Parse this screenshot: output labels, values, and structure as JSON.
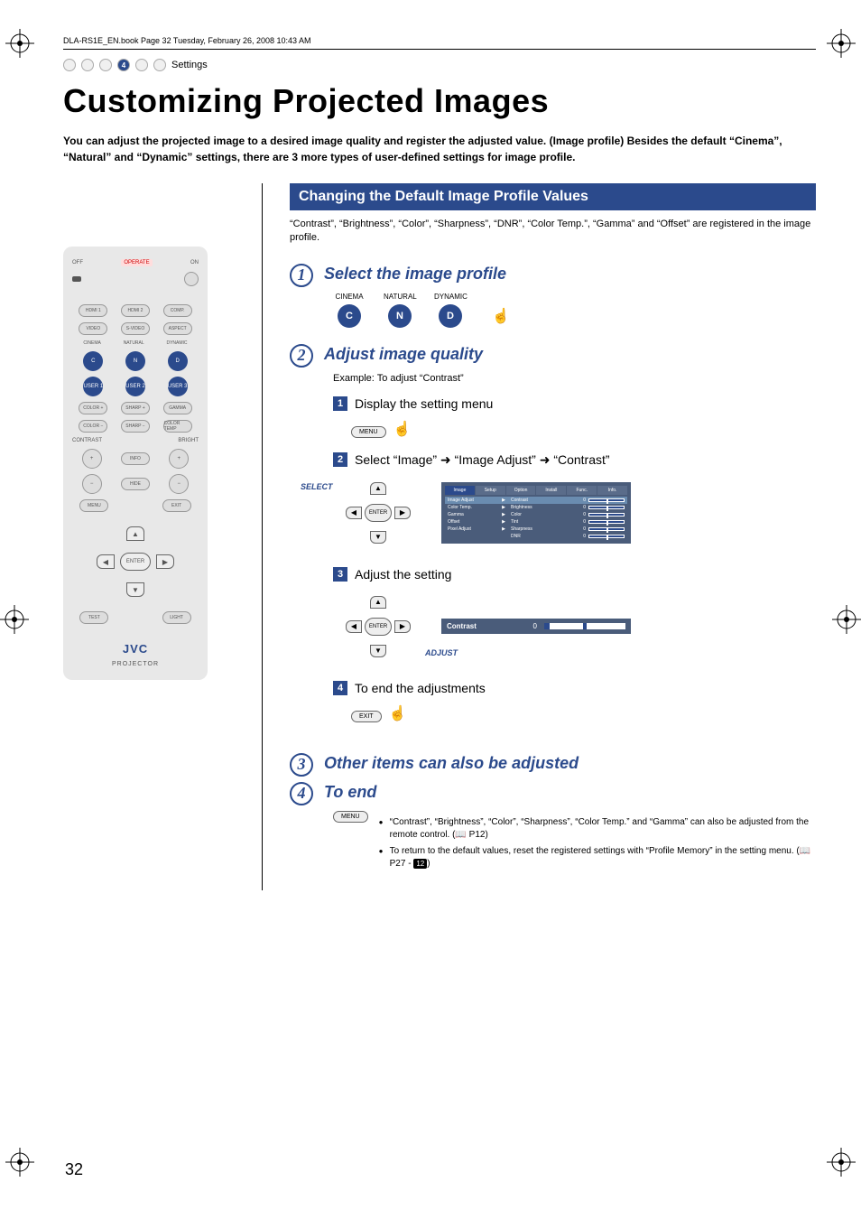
{
  "header_line": "DLA-RS1E_EN.book  Page 32  Tuesday, February 26, 2008  10:43 AM",
  "nav": {
    "num": "4",
    "label": "Settings"
  },
  "title": "Customizing Projected Images",
  "intro": "You can adjust the projected image to a desired image quality and register the adjusted value. (Image profile) Besides the default “Cinema”, “Natural” and “Dynamic” settings, there are 3 more types of user-defined settings for image profile.",
  "section_title": "Changing the Default Image Profile Values",
  "registered_note": "“Contrast”, “Brightness”, “Color”, “Sharpness”, “DNR”, “Color Temp.”, “Gamma” and “Offset” are registered in the image profile.",
  "steps": {
    "s1": {
      "title": "Select the image profile",
      "profiles": {
        "cinema": "CINEMA",
        "natural": "NATURAL",
        "dynamic": "DYNAMIC",
        "c": "C",
        "n": "N",
        "d": "D"
      }
    },
    "s2": {
      "title": "Adjust image quality",
      "example": "Example: To adjust “Contrast”",
      "sub1": "Display the setting menu",
      "sub2": "Select “Image” ➜ “Image Adjust” ➜ “Contrast”",
      "sub3": "Adjust the setting",
      "sub4": "To end the adjustments"
    },
    "s3": {
      "title": "Other items can also be adjusted"
    },
    "s4": {
      "title": "To end"
    }
  },
  "labels": {
    "select": "SELECT",
    "adjust": "ADJUST",
    "enter": "ENTER",
    "menu": "MENU",
    "exit": "EXIT"
  },
  "osd": {
    "tabs": [
      "Image",
      "Setup",
      "Option",
      "Install",
      "Func.",
      "Info."
    ],
    "left": [
      "Image Adjust",
      "Color Temp.",
      "Gamma",
      "Offset",
      "Pixel Adjust"
    ],
    "right": [
      {
        "name": "Contrast",
        "val": "0"
      },
      {
        "name": "Brightness",
        "val": "0"
      },
      {
        "name": "Color",
        "val": "0"
      },
      {
        "name": "Tint",
        "val": "0"
      },
      {
        "name": "Sharpness",
        "val": "0"
      },
      {
        "name": "DNR",
        "val": "0"
      }
    ]
  },
  "adjust_bar": {
    "label": "Contrast",
    "value": "0"
  },
  "end_notes": {
    "b1": "“Contrast”, “Brightness”, “Color”, “Sharpness”, “Color Temp.” and “Gamma” can also be adjusted from the remote control. (📖 P12)",
    "b2_a": "To return to the default values, reset the registered settings with “Profile Memory” in the setting menu. (📖 P27 - ",
    "b2_badge": "12",
    "b2_c": ")"
  },
  "remote": {
    "off": "OFF",
    "operate": "OPERATE",
    "on": "ON",
    "hdmi1": "HDMI 1",
    "hdmi2": "HDMI 2",
    "comp": "COMP.",
    "video": "VIDEO",
    "svideo": "S-VIDEO",
    "aspect": "ASPECT",
    "cinema": "CINEMA",
    "natural": "NATURAL",
    "dynamic": "DYNAMIC",
    "user1": "USER 1",
    "user2": "USER 2",
    "user3": "USER 3",
    "colorp": "COLOR +",
    "sharpp": "SHARP +",
    "gamma": "GAMMA",
    "colorm": "COLOR −",
    "sharpm": "SHARP −",
    "colortemp": "COLOR TEMP",
    "contrast": "CONTRAST",
    "bright": "BRIGHT",
    "info": "INFO",
    "hide": "HIDE",
    "menu": "MENU",
    "exit": "EXIT",
    "enter": "ENTER",
    "test": "TEST",
    "light": "LIGHT",
    "brand": "JVC",
    "sub": "PROJECTOR"
  },
  "page_number": "32"
}
